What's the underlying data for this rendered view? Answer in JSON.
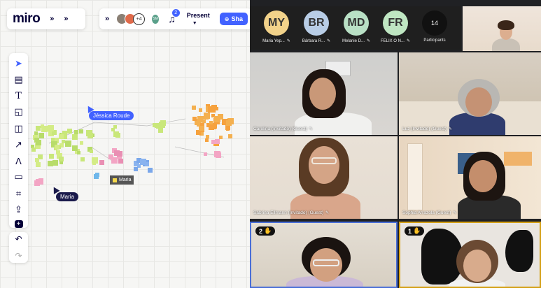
{
  "miro": {
    "logo": "miro",
    "present_label": "Present",
    "share_label": "Sha",
    "notification_count": "2",
    "extra_collaborators": "+4",
    "collaborator_initials": "SM",
    "cursors": [
      {
        "name": "Jéssica Roude"
      },
      {
        "name": "Maria"
      }
    ],
    "selection_tag": "Maria"
  },
  "call": {
    "participants": [
      {
        "initials": "MY",
        "name": "Maria Yep...",
        "color": "#f2d28a"
      },
      {
        "initials": "BR",
        "name": "Bárbara R...",
        "color": "#b8cde6"
      },
      {
        "initials": "MD",
        "name": "Melanie D...",
        "color": "#b9e0c5"
      },
      {
        "initials": "FR",
        "name": "FELIX O N...",
        "color": "#bfe6c2"
      }
    ],
    "participant_count": "14",
    "participants_label": "Participants",
    "tiles": [
      {
        "label": "Carolina (Invitado) (Guest)"
      },
      {
        "label": "Luz (Invitado) (Guest)"
      },
      {
        "label": "Sabrina Ellmann (Invitado) (Guest)"
      },
      {
        "label": "Sophia Arrazola (Guest)"
      },
      {
        "hand_count": "2"
      },
      {
        "hand_count": "1"
      }
    ]
  }
}
